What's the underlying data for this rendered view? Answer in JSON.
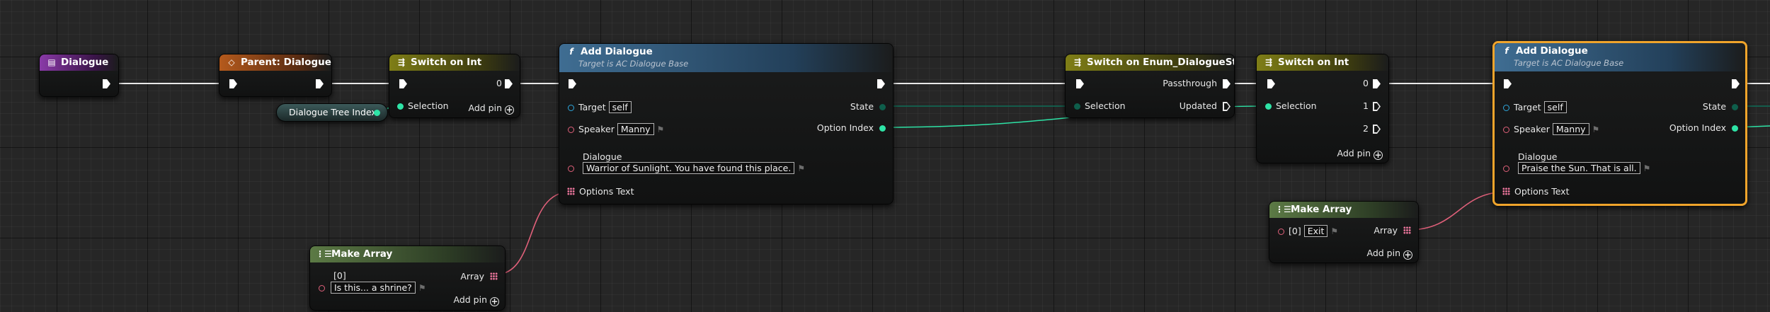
{
  "colors": {
    "exec": "#ffffff",
    "pin_object": "#2ea7dd",
    "pin_text": "#e0607a",
    "pin_int": "#2ee3a6",
    "pin_enum": "#0e5e4b",
    "selection_outline": "#f0a42b"
  },
  "nodes": {
    "dialogue_event": {
      "title": "Dialogue",
      "icon": "event-icon"
    },
    "parent_dialogue": {
      "title": "Parent: Dialogue",
      "icon": "function-override-icon"
    },
    "dialogue_tree_index": {
      "label": "Dialogue Tree Index"
    },
    "switch_int_1": {
      "title": "Switch on Int",
      "selection": "Selection",
      "case0": "0",
      "add_pin": "Add pin"
    },
    "add_dialogue_1": {
      "title": "Add Dialogue",
      "subtitle": "Target is AC Dialogue Base",
      "target_label": "Target",
      "target_value": "self",
      "speaker_label": "Speaker",
      "speaker_value": "Manny",
      "dialogue_label": "Dialogue",
      "dialogue_value": "Warrior of Sunlight. You have found this place.",
      "options_label": "Options Text",
      "state_label": "State",
      "option_index_label": "Option Index"
    },
    "make_array_1": {
      "title": "Make Array",
      "index_label": "[0]",
      "value": "Is this... a shrine?",
      "array_label": "Array",
      "add_pin": "Add pin"
    },
    "switch_enum": {
      "title": "Switch on Enum_DialogueState",
      "selection": "Selection",
      "passthrough": "Passthrough",
      "updated": "Updated"
    },
    "switch_int_2": {
      "title": "Switch on Int",
      "selection": "Selection",
      "case0": "0",
      "case1": "1",
      "case2": "2",
      "add_pin": "Add pin"
    },
    "make_array_2": {
      "title": "Make Array",
      "index_label": "[0]",
      "value": "Exit",
      "array_label": "Array",
      "add_pin": "Add pin"
    },
    "add_dialogue_2": {
      "title": "Add Dialogue",
      "subtitle": "Target is AC Dialogue Base",
      "target_label": "Target",
      "target_value": "self",
      "speaker_label": "Speaker",
      "speaker_value": "Manny",
      "dialogue_label": "Dialogue",
      "dialogue_value": "Praise the Sun. That is all.",
      "options_label": "Options Text",
      "state_label": "State",
      "option_index_label": "Option Index"
    }
  }
}
